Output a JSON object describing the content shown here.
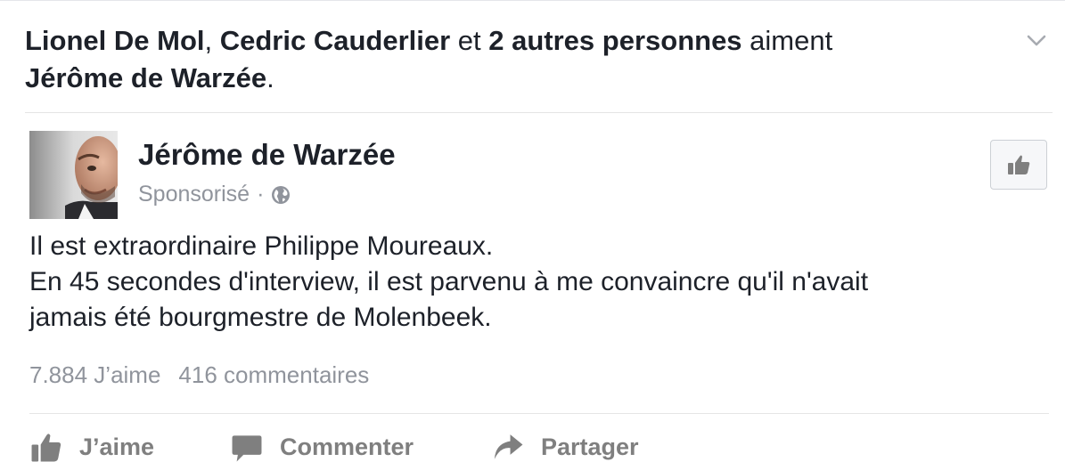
{
  "story": {
    "liker1": "Lionel De Mol",
    "sep1": ", ",
    "liker2": "Cedric Cauderlier",
    "connector": " et ",
    "others": "2 autres personnes",
    "verb": " aiment ",
    "liked_page": "Jérôme de Warzée",
    "end": "."
  },
  "post": {
    "page_name": "Jérôme de Warzée",
    "sponsored_label": "Sponsorisé",
    "meta_separator": "·",
    "privacy_icon": "globe-icon",
    "text_lines": [
      "Il est extraordinaire Philippe Moureaux.",
      "En 45 secondes d'interview, il est parvenu à me convaincre qu'il n'avait",
      "jamais été bourgmestre de Molenbeek."
    ]
  },
  "counts": {
    "likes": "7.884 J’aime",
    "comments": "416 commentaires"
  },
  "actions": {
    "like": "J’aime",
    "comment": "Commenter",
    "share": "Partager"
  },
  "colors": {
    "text": "#1d2129",
    "muted": "#90949c",
    "action": "#7f7f7f",
    "divider": "#e5e5e5"
  }
}
